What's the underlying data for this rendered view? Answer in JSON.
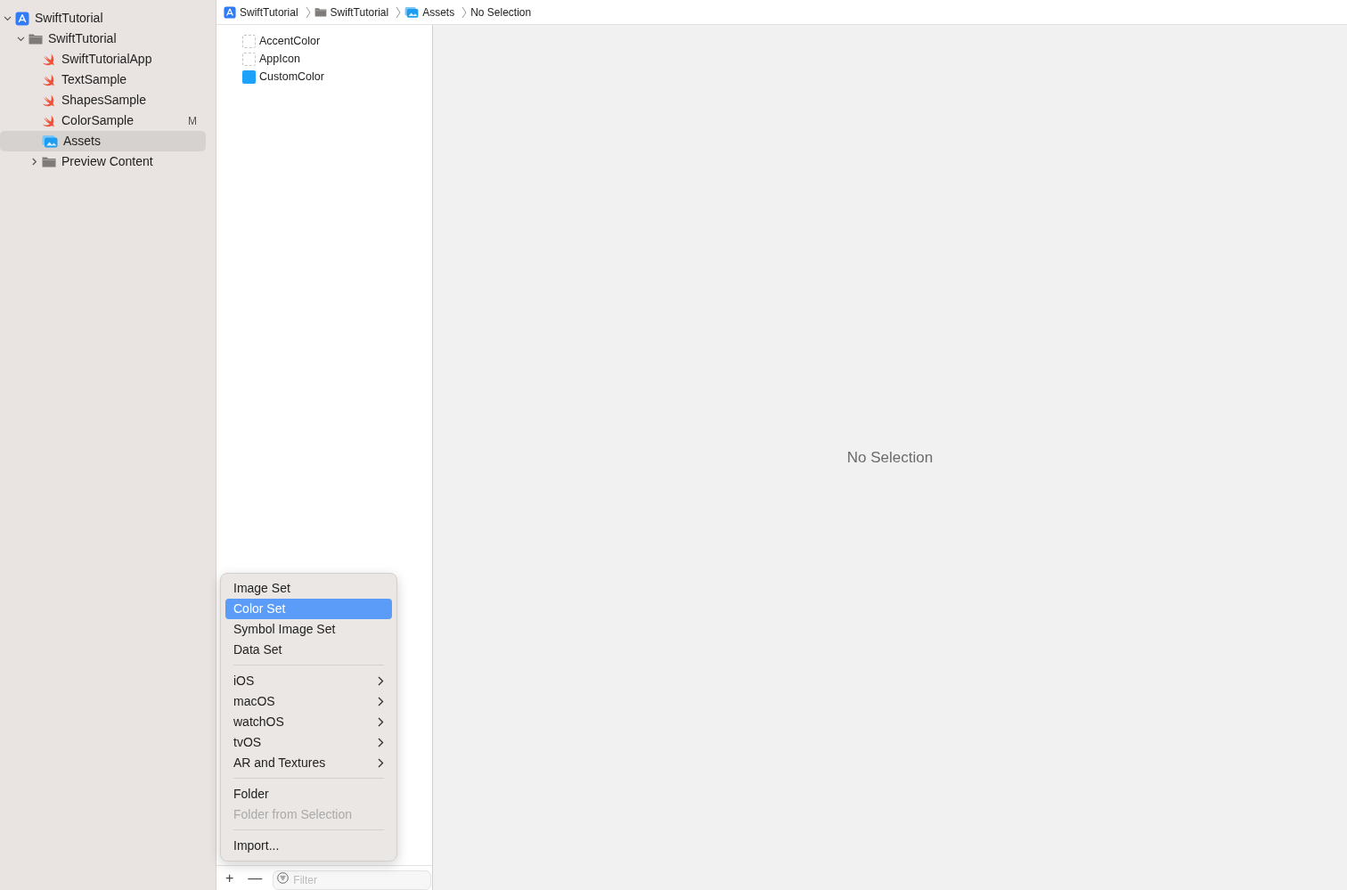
{
  "sidebar": {
    "items": [
      {
        "label": "SwiftTutorial",
        "kind": "project",
        "expanded": true,
        "selected": false,
        "children": [
          {
            "label": "SwiftTutorial",
            "kind": "folder",
            "expanded": true,
            "selected": false,
            "children": [
              {
                "label": "SwiftTutorialApp",
                "kind": "swift",
                "selected": false
              },
              {
                "label": "TextSample",
                "kind": "swift",
                "selected": false
              },
              {
                "label": "ShapesSample",
                "kind": "swift",
                "selected": false
              },
              {
                "label": "ColorSample",
                "kind": "swift",
                "selected": false,
                "badge": "M"
              },
              {
                "label": "Assets",
                "kind": "assets",
                "selected": true
              },
              {
                "label": "Preview Content",
                "kind": "folder",
                "expanded": false,
                "selected": false
              }
            ]
          }
        ]
      }
    ]
  },
  "breadcrumb": [
    {
      "label": "SwiftTutorial",
      "kind": "project"
    },
    {
      "label": "SwiftTutorial",
      "kind": "folder"
    },
    {
      "label": "Assets",
      "kind": "assets"
    },
    {
      "label": "No Selection",
      "kind": "plain"
    }
  ],
  "assets": [
    {
      "label": "AccentColor",
      "kind": "empty",
      "selected": false
    },
    {
      "label": "AppIcon",
      "kind": "empty",
      "selected": false
    },
    {
      "label": "CustomColor",
      "kind": "color",
      "color": "#1ea1f8",
      "selected": false
    }
  ],
  "detail": {
    "message": "No Selection"
  },
  "menu": [
    {
      "kind": "item",
      "label": "Image Set",
      "selected": false,
      "disabled": false
    },
    {
      "kind": "item",
      "label": "Color Set",
      "selected": true,
      "disabled": false
    },
    {
      "kind": "item",
      "label": "Symbol Image Set",
      "selected": false,
      "disabled": false
    },
    {
      "kind": "item",
      "label": "Data Set",
      "selected": false,
      "disabled": false
    },
    {
      "kind": "separator"
    },
    {
      "kind": "submenu",
      "label": "iOS",
      "selected": false,
      "disabled": false
    },
    {
      "kind": "submenu",
      "label": "macOS",
      "selected": false,
      "disabled": false
    },
    {
      "kind": "submenu",
      "label": "watchOS",
      "selected": false,
      "disabled": false
    },
    {
      "kind": "submenu",
      "label": "tvOS",
      "selected": false,
      "disabled": false
    },
    {
      "kind": "submenu",
      "label": "AR and Textures",
      "selected": false,
      "disabled": false
    },
    {
      "kind": "separator"
    },
    {
      "kind": "item",
      "label": "Folder",
      "selected": false,
      "disabled": false
    },
    {
      "kind": "item",
      "label": "Folder from Selection",
      "selected": false,
      "disabled": true
    },
    {
      "kind": "separator"
    },
    {
      "kind": "item",
      "label": "Import...",
      "selected": false,
      "disabled": false
    }
  ],
  "bottom_bar": {
    "add": "+",
    "remove": "—",
    "filter": {
      "placeholder": "Filter"
    }
  }
}
